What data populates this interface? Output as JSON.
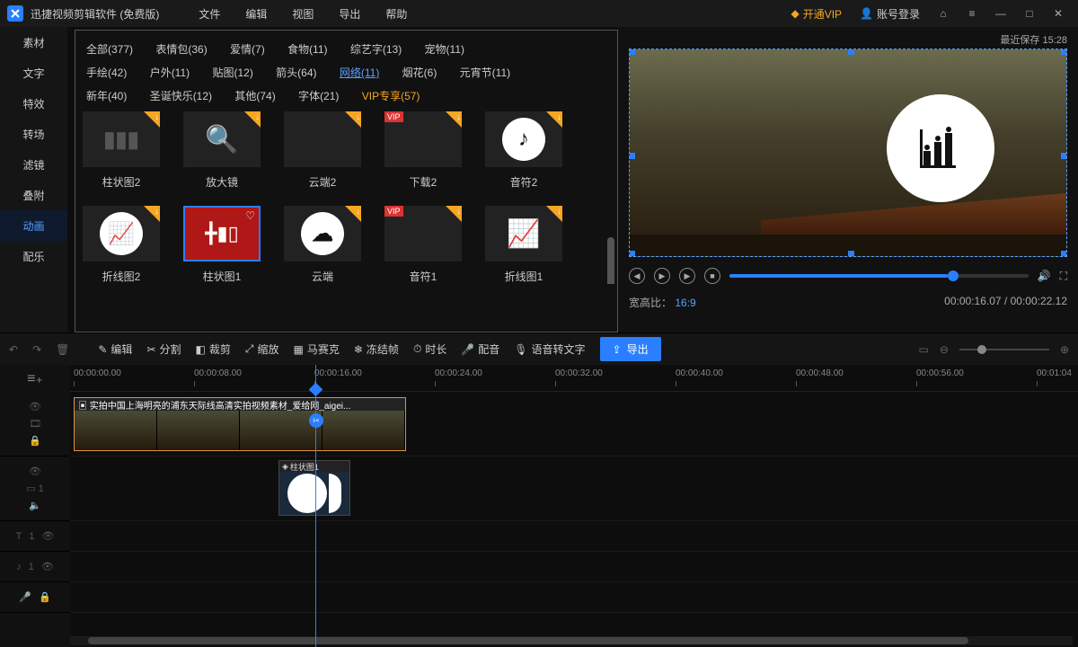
{
  "titlebar": {
    "appname": "迅捷视频剪辑软件 (免费版)",
    "menu": [
      "文件",
      "编辑",
      "视图",
      "导出",
      "帮助"
    ],
    "vip": "开通VIP",
    "login": "账号登录"
  },
  "leftnav": {
    "items": [
      "素材",
      "文字",
      "特效",
      "转场",
      "滤镜",
      "叠附",
      "动画",
      "配乐"
    ],
    "active_index": 6
  },
  "tags": {
    "row1": [
      {
        "label": "全部(377)"
      },
      {
        "label": "表情包(36)"
      },
      {
        "label": "爱情(7)"
      },
      {
        "label": "食物(11)"
      },
      {
        "label": "综艺字(13)"
      },
      {
        "label": "宠物(11)"
      }
    ],
    "row2": [
      {
        "label": "手绘(42)"
      },
      {
        "label": "户外(11)"
      },
      {
        "label": "贴图(12)"
      },
      {
        "label": "箭头(64)"
      },
      {
        "label": "网络(11)",
        "sel": true
      },
      {
        "label": "烟花(6)"
      },
      {
        "label": "元宵节(11)"
      }
    ],
    "row3": [
      {
        "label": "新年(40)"
      },
      {
        "label": "圣诞快乐(12)"
      },
      {
        "label": "其他(74)"
      },
      {
        "label": "字体(21)"
      },
      {
        "label": "VIP专享(57)",
        "vip": true
      }
    ]
  },
  "assets": [
    {
      "name": "柱状图2",
      "kind": "barchart-white"
    },
    {
      "name": "放大镜",
      "kind": "magnify"
    },
    {
      "name": "云端2",
      "kind": "cloud"
    },
    {
      "name": "下载2",
      "kind": "download",
      "vip": true
    },
    {
      "name": "音符2",
      "kind": "note-white"
    },
    {
      "name": "折线图2",
      "kind": "linechart-white"
    },
    {
      "name": "柱状图1",
      "kind": "barchart-sel",
      "selected": true,
      "fav": true
    },
    {
      "name": "云端",
      "kind": "cloud-white"
    },
    {
      "name": "音符1",
      "kind": "note",
      "vip": true
    },
    {
      "name": "折线图1",
      "kind": "linechart"
    }
  ],
  "preview": {
    "saved_label": "最近保存 15:28",
    "aspect_label": "宽高比：",
    "aspect_value": "16:9",
    "time_current": "00:00:16.07",
    "time_total": "00:00:22.12"
  },
  "toolbar": {
    "edit": "编辑",
    "split": "分割",
    "crop": "裁剪",
    "scale": "缩放",
    "mosaic": "马赛克",
    "freeze": "冻结帧",
    "duration": "时长",
    "dub": "配音",
    "stt": "语音转文字",
    "export": "导出"
  },
  "timeline": {
    "ticks": [
      "00:00:00.00",
      "00:00:08.00",
      "00:00:16.00",
      "00:00:24.00",
      "00:00:32.00",
      "00:00:40.00",
      "00:00:48.00",
      "00:00:56.00",
      "00:01:04"
    ],
    "video_clip_title": "实拍中国上海明亮的浦东天际线高清实拍视频素材_爱给网_aigei...",
    "anim_clip_label": "柱状图1",
    "track_labels": {
      "video": "",
      "pip": "1",
      "text": "1",
      "audio": "1"
    }
  }
}
